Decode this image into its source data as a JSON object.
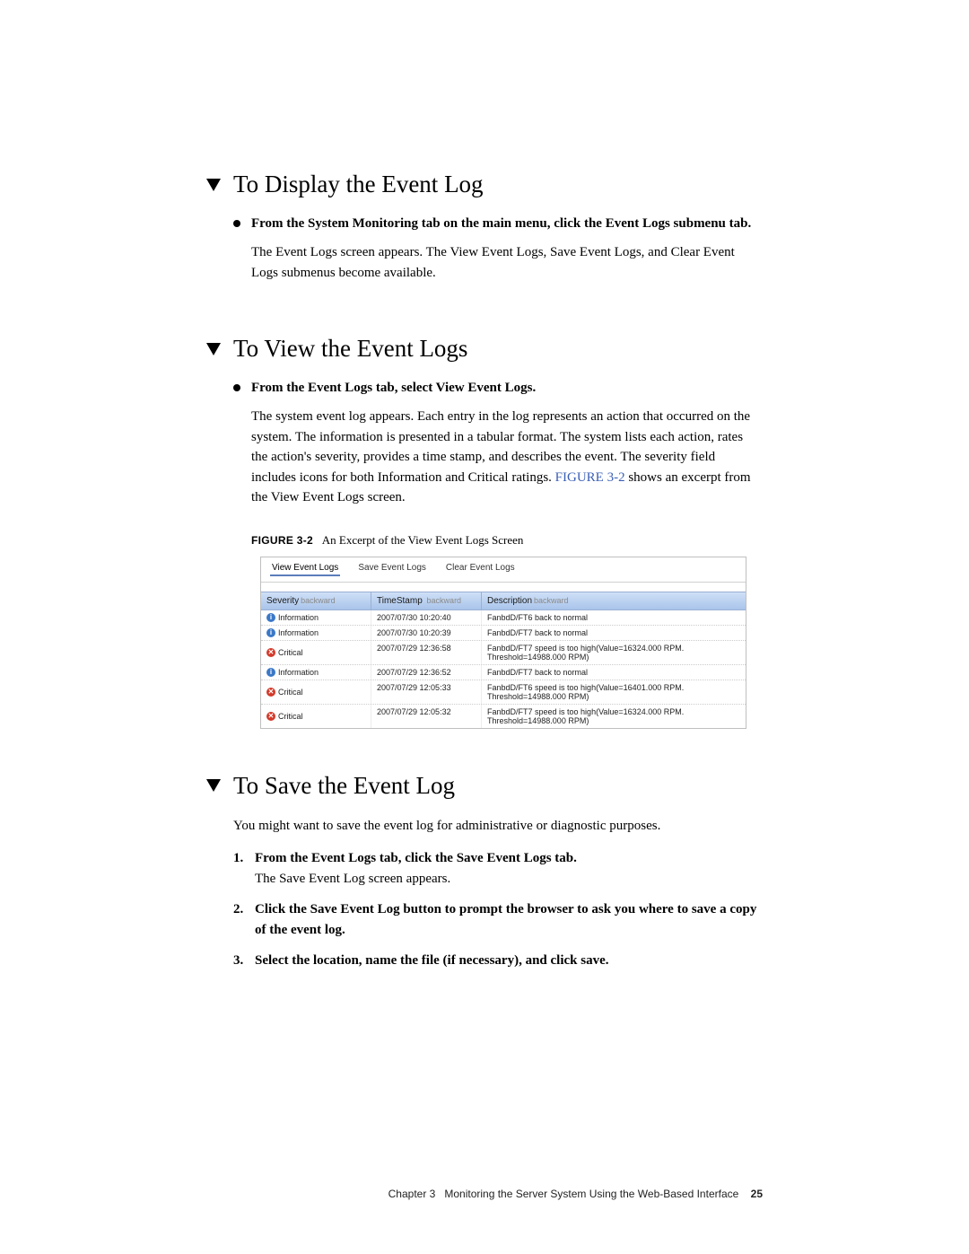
{
  "section1": {
    "heading": "To Display the Event Log",
    "bullet_bold": "From the System Monitoring tab on the main menu, click the Event Logs submenu tab.",
    "para": "The Event Logs screen appears. The View Event Logs, Save Event Logs, and Clear Event Logs submenus become available."
  },
  "section2": {
    "heading": "To View the Event Logs",
    "bullet_bold": "From the Event Logs tab, select View Event Logs.",
    "para_pre": "The system event log appears. Each entry in the log represents an action that occurred on the system. The information is presented in a tabular format. The system lists each action, rates the action's severity, provides a time stamp, and describes the event. The severity field includes icons for both Information and Critical ratings. ",
    "figref": "FIGURE 3-2",
    "para_post": " shows an excerpt from the View Event Logs screen.",
    "figure_label": "FIGURE 3-2",
    "figure_caption": "An Excerpt of the View Event Logs Screen"
  },
  "shot": {
    "tabs": [
      "View Event Logs",
      "Save Event Logs",
      "Clear Event Logs"
    ],
    "headers": {
      "severity": "Severity",
      "timestamp": "TimeStamp",
      "description": "Description",
      "backward": "backward"
    },
    "rows": [
      {
        "sev": "Information",
        "ico": "info",
        "ts": "2007/07/30 10:20:40",
        "desc": "FanbdD/FT6 back to normal"
      },
      {
        "sev": "Information",
        "ico": "info",
        "ts": "2007/07/30 10:20:39",
        "desc": "FanbdD/FT7 back to normal"
      },
      {
        "sev": "Critical",
        "ico": "crit",
        "ts": "2007/07/29 12:36:58",
        "desc": "FanbdD/FT7 speed is too high(Value=16324.000 RPM. Threshold=14988.000 RPM)"
      },
      {
        "sev": "Information",
        "ico": "info",
        "ts": "2007/07/29 12:36:52",
        "desc": "FanbdD/FT7 back to normal"
      },
      {
        "sev": "Critical",
        "ico": "crit",
        "ts": "2007/07/29 12:05:33",
        "desc": "FanbdD/FT6 speed is too high(Value=16401.000 RPM. Threshold=14988.000 RPM)"
      },
      {
        "sev": "Critical",
        "ico": "crit",
        "ts": "2007/07/29 12:05:32",
        "desc": "FanbdD/FT7 speed is too high(Value=16324.000 RPM. Threshold=14988.000 RPM)"
      }
    ]
  },
  "section3": {
    "heading": "To Save the Event Log",
    "intro": "You might want to save the event log for administrative or diagnostic purposes.",
    "steps": [
      {
        "bold": "From the Event Logs tab, click the Save Event Logs tab.",
        "plain": "The Save Event Log screen appears."
      },
      {
        "bold": "Click the Save Event Log button to prompt the browser to ask you where to save a copy of the event log.",
        "plain": ""
      },
      {
        "bold": "Select the location, name the file (if necessary), and click save.",
        "plain": ""
      }
    ]
  },
  "footer": {
    "chapter": "Chapter 3",
    "title": "Monitoring the Server System Using the Web-Based Interface",
    "page": "25"
  }
}
